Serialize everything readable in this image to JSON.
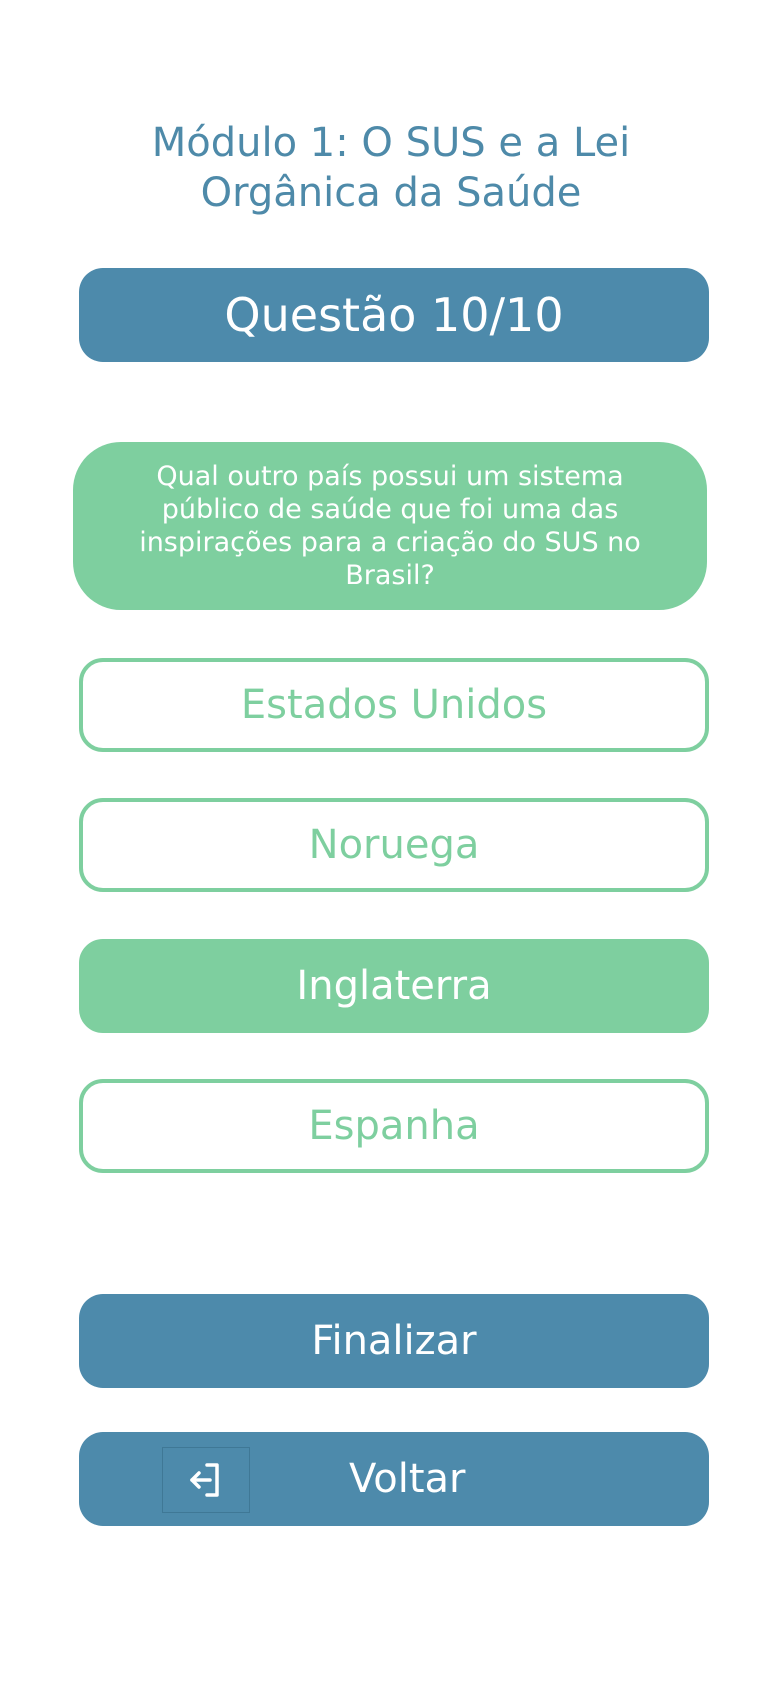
{
  "module_title": "Módulo 1: O SUS e a Lei Orgânica da Saúde",
  "question_header": "Questão 10/10",
  "question_text": "Qual outro país possui um sistema público de saúde que foi uma das inspirações para a criação do SUS no Brasil?",
  "options": [
    {
      "label": "Estados Unidos",
      "selected": false
    },
    {
      "label": "Noruega",
      "selected": false
    },
    {
      "label": "Inglaterra",
      "selected": true
    },
    {
      "label": "Espanha",
      "selected": false
    }
  ],
  "finish_button": {
    "label": "Finalizar"
  },
  "back_button": {
    "label": "Voltar",
    "icon": "exit-arrow-icon"
  },
  "colors": {
    "primary_blue": "#4d8aab",
    "accent_green": "#7ecf9f",
    "title_blue": "#4e8aa9",
    "background": "#ffffff"
  }
}
